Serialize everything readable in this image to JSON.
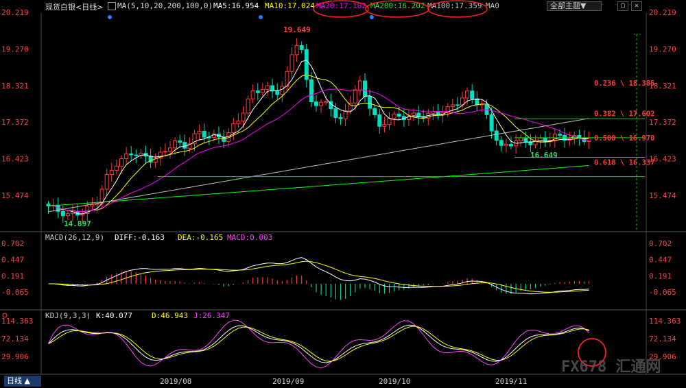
{
  "header": {
    "instrument": "现货白银<日线>",
    "ma_def": "MA(5,10,20,200,100,0)",
    "ma5": "MA5:16.954",
    "ma10": "MA10:17.024",
    "ma20": "MA20:17.102",
    "ma200": "MA200:16.202",
    "ma100": "MA100:17.359",
    "ma0": "MA0",
    "theme_label": "全部主题▼",
    "colors": {
      "ma5": "#ffffff",
      "ma10": "#ffff00",
      "ma20": "#ff00ff",
      "ma200": "#00ff00",
      "ma100": "#c0c0c0"
    }
  },
  "price_axis": [
    "20.219",
    "19.270",
    "18.321",
    "17.372",
    "16.423",
    "15.474"
  ],
  "annotations": {
    "high": "19.649",
    "low": "14.897",
    "recent_low": "16.649"
  },
  "fibonacci": [
    {
      "label": "0.236 \\ 18.385",
      "value": 18.385
    },
    {
      "label": "0.382 \\ 17.602",
      "value": 17.602
    },
    {
      "label": "0.500 \\ 16.970",
      "value": 16.97
    },
    {
      "label": "0.618 \\ 16.337",
      "value": 16.337
    }
  ],
  "macd": {
    "title": "MACD(26,12,9)",
    "diff": "DIFF:-0.163",
    "dea": "DEA:-0.165",
    "macd": "MACD:0.003",
    "axis": [
      "0.702",
      "0.447",
      "0.191",
      "-0.065"
    ]
  },
  "kdj": {
    "title": "KDJ(9,3,3)",
    "k": "K:40.077",
    "d": "D:46.943",
    "j": "J:26.347",
    "axis": [
      "114.363",
      "72.134",
      "29.906"
    ]
  },
  "x_axis": [
    "2019/08",
    "2019/09",
    "2019/10",
    "2019/11"
  ],
  "period_button": "日线 ▲",
  "watermark": "FX678 汇通网"
}
